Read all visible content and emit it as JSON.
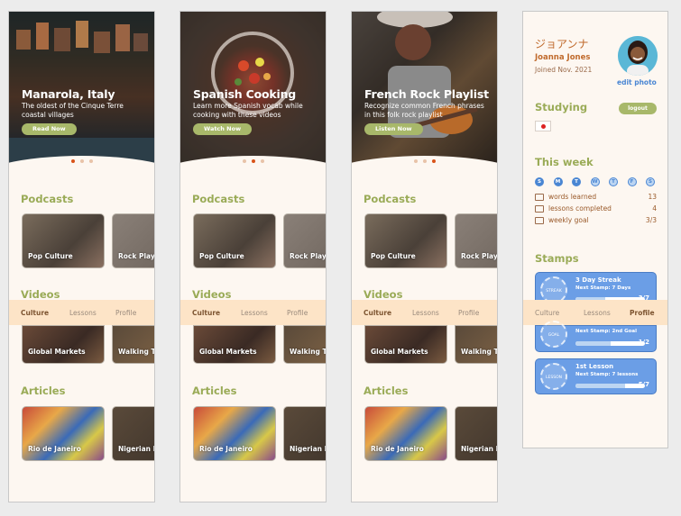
{
  "screens": [
    {
      "hero_title": "Manarola, Italy",
      "hero_sub": "The oldest of the Cinque Terre coastal villages",
      "hero_btn": "Read Now",
      "active_dot": 0
    },
    {
      "hero_title": "Spanish Cooking",
      "hero_sub": "Learn more Spanish vocab while cooking with these videos",
      "hero_btn": "Watch Now",
      "active_dot": 1
    },
    {
      "hero_title": "French Rock Playlist",
      "hero_sub": "Recognize common French phrases in this folk rock playlist",
      "hero_btn": "Listen Now",
      "active_dot": 2
    }
  ],
  "sections": {
    "podcasts": "Podcasts",
    "videos": "Videos",
    "articles": "Articles"
  },
  "cards": {
    "podcast_1": "Pop Culture",
    "podcast_2": "Rock Play",
    "video_1": "Global Markets",
    "video_2": "Walking T",
    "article_1": "Rio de Janeiro",
    "article_2": "Nigerian I"
  },
  "tabs": {
    "culture": "Culture",
    "lessons": "Lessons",
    "profile": "Profile"
  },
  "profile": {
    "jp_name": "ジョアンナ",
    "name": "Joanna Jones",
    "joined": "Joined Nov. 2021",
    "edit_photo": "edit photo",
    "studying_title": "Studying",
    "logout": "logout",
    "week_title": "This week",
    "days": [
      "S",
      "M",
      "T",
      "W",
      "T",
      "F",
      "S"
    ],
    "days_done": 3,
    "stats": [
      {
        "label": "words learned",
        "value": "13"
      },
      {
        "label": "lessons completed",
        "value": "4"
      },
      {
        "label": "weekly goal",
        "value": "3/3"
      }
    ],
    "stamps_title": "Stamps",
    "stamps": [
      {
        "title": "3 Day Streak",
        "next": "Next Stamp: 7 Days",
        "count": "3/7",
        "badge": "STREAK",
        "progress": 0.43
      },
      {
        "title": "",
        "next": "Next Stamp: 2nd Goal",
        "count": "1/2",
        "badge": "GOAL",
        "progress": 0.5
      },
      {
        "title": "1st Lesson",
        "next": "Next Stamp: 7 lessons",
        "count": "5/7",
        "badge": "LESSON",
        "progress": 0.71
      }
    ]
  },
  "colors": {
    "accent_green": "#9aab57",
    "accent_orange": "#d9541a",
    "tab_bg": "#fde4c7",
    "stamp_blue": "#6b9ee6"
  }
}
